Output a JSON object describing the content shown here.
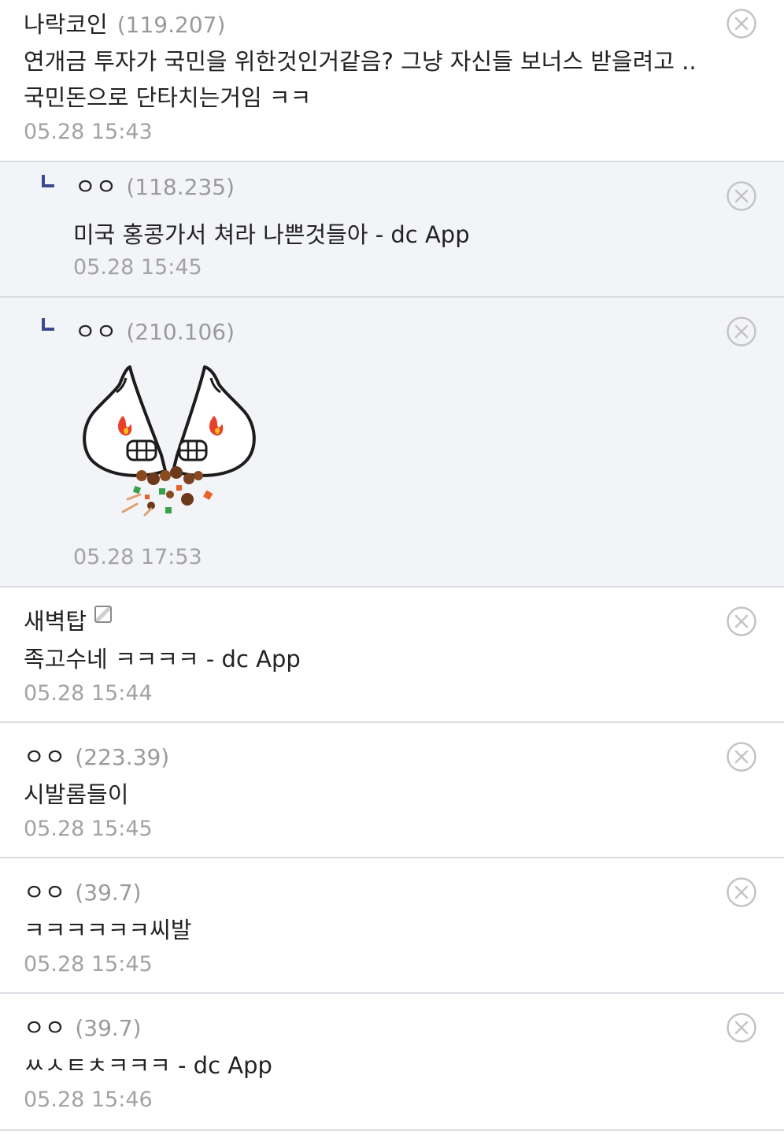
{
  "comments": [
    {
      "nick": "나락코인",
      "ip": "(119.207)",
      "lines": [
        "연개금 투자가 국민을 위한것인거같음? 그냥 자신들 보너스 받을려고 ..",
        "국민돈으로 단타치는거임 ㅋㅋ"
      ],
      "date": "05.28 15:43"
    },
    {
      "nick": "ㅇㅇ",
      "ip": "(118.235)",
      "lines": [
        "미국 홍콩가서 쳐라 나쁜것들아 - dc App"
      ],
      "date": "05.28 15:45"
    },
    {
      "nick": "ㅇㅇ",
      "ip": "(210.106)",
      "emoticon": "angry-crying-dumpling-emoticon",
      "date": "05.28 17:53"
    },
    {
      "nick": "새벽탑",
      "fixed_nick_icon": "fixed-nick-icon",
      "lines": [
        "족고수네 ㅋㅋㅋㅋ - dc App"
      ],
      "date": "05.28 15:44"
    },
    {
      "nick": "ㅇㅇ",
      "ip": "(223.39)",
      "lines": [
        "시발롬들이"
      ],
      "date": "05.28 15:45"
    },
    {
      "nick": "ㅇㅇ",
      "ip": "(39.7)",
      "lines": [
        "ㅋㅋㅋㅋㅋㅋ씨발"
      ],
      "date": "05.28 15:45"
    },
    {
      "nick": "ㅇㅇ",
      "ip": "(39.7)",
      "lines": [
        "ㅆㅅㅌㅊㅋㅋㅋ - dc App"
      ],
      "date": "05.28 15:46"
    }
  ],
  "icons": {
    "delete": "close-circle-icon",
    "reply": "reply-arrow-icon"
  },
  "colors": {
    "reply_background": "#f3f4f8",
    "divider": "#dcdde3",
    "meta_gray": "#a3a3a3",
    "reply_mark": "#3b4a8f"
  }
}
